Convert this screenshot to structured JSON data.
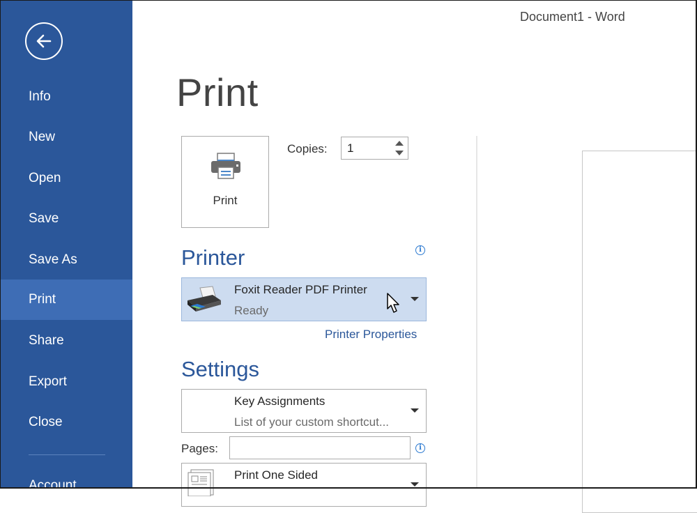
{
  "window": {
    "title": "Document1 - Word"
  },
  "sidebar": {
    "back_icon": "back-arrow-circle-icon",
    "items": [
      {
        "label": "Info",
        "active": false
      },
      {
        "label": "New",
        "active": false
      },
      {
        "label": "Open",
        "active": false
      },
      {
        "label": "Save",
        "active": false
      },
      {
        "label": "Save As",
        "active": false
      },
      {
        "label": "Print",
        "active": true
      },
      {
        "label": "Share",
        "active": false
      },
      {
        "label": "Export",
        "active": false
      },
      {
        "label": "Close",
        "active": false
      },
      {
        "label": "Account",
        "active": false
      }
    ],
    "colors": {
      "background": "#2b579a",
      "active": "#3e6db5"
    }
  },
  "main": {
    "title": "Print",
    "print_button": {
      "label": "Print",
      "icon": "printer-icon"
    },
    "copies": {
      "label": "Copies:",
      "value": "1"
    },
    "printer_section": {
      "heading": "Printer",
      "info_icon": "info-icon",
      "selected_printer": {
        "name": "Foxit Reader PDF Printer",
        "status": "Ready",
        "icon": "printer-device-icon"
      },
      "properties_link": "Printer Properties"
    },
    "settings_section": {
      "heading": "Settings",
      "print_what": {
        "title": "Key Assignments",
        "subtitle": "List of your custom shortcut..."
      },
      "pages": {
        "label": "Pages:",
        "value": "",
        "info_icon": "info-icon"
      },
      "sides": {
        "title": "Print One Sided",
        "icon": "one-sided-page-icon"
      }
    }
  }
}
